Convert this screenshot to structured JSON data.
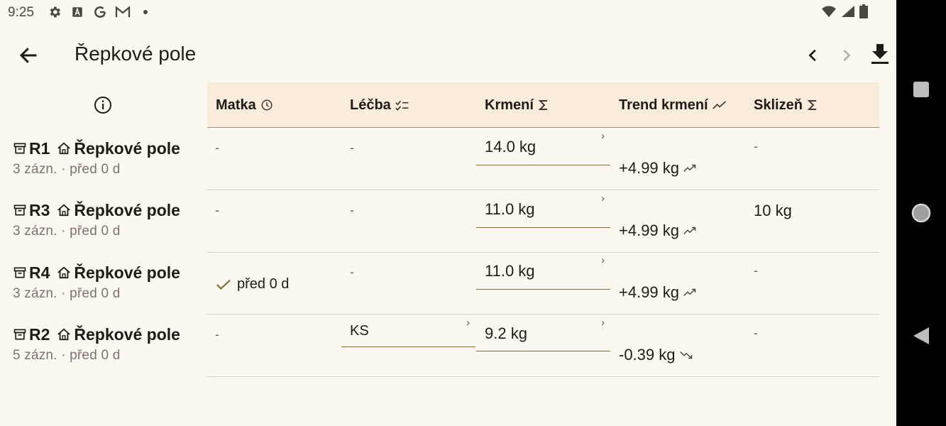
{
  "status": {
    "time": "9:25"
  },
  "appbar": {
    "title": "Řepkové pole"
  },
  "columns": [
    {
      "label": "Matka",
      "icon": "clock-icon"
    },
    {
      "label": "Léčba",
      "icon": "checklist-icon"
    },
    {
      "label": "Krmení",
      "icon": "sigma-icon"
    },
    {
      "label": "Trend krmení",
      "icon": "trend-icon"
    },
    {
      "label": "Sklizeň",
      "icon": "sigma-icon"
    }
  ],
  "rows": [
    {
      "hive": "R1",
      "location": "Řepkové pole",
      "sub": "3 zázn. · před 0 d",
      "queen": "-",
      "treatment": "-",
      "feeding": "14.0 kg",
      "trend": "+4.99 kg",
      "harvest": "-"
    },
    {
      "hive": "R3",
      "location": "Řepkové pole",
      "sub": "3 zázn. · před 0 d",
      "queen": "-",
      "treatment": "-",
      "feeding": "11.0 kg",
      "trend": "+4.99 kg",
      "harvest": "10 kg"
    },
    {
      "hive": "R4",
      "location": "Řepkové pole",
      "sub": "3 zázn. · před 0 d",
      "queen": "před 0 d",
      "treatment": "-",
      "feeding": "11.0 kg",
      "trend": "+4.99 kg",
      "harvest": "-"
    },
    {
      "hive": "R2",
      "location": "Řepkové pole",
      "sub": "5 zázn. · před 0 d",
      "queen": "-",
      "treatment": "KS",
      "feeding": "9.2 kg",
      "trend": "-0.39 kg",
      "harvest": "-"
    }
  ],
  "colors": {
    "accent": "#7d6e3a",
    "header_bg": "#f9ecdb",
    "background": "#fdf7f1"
  }
}
